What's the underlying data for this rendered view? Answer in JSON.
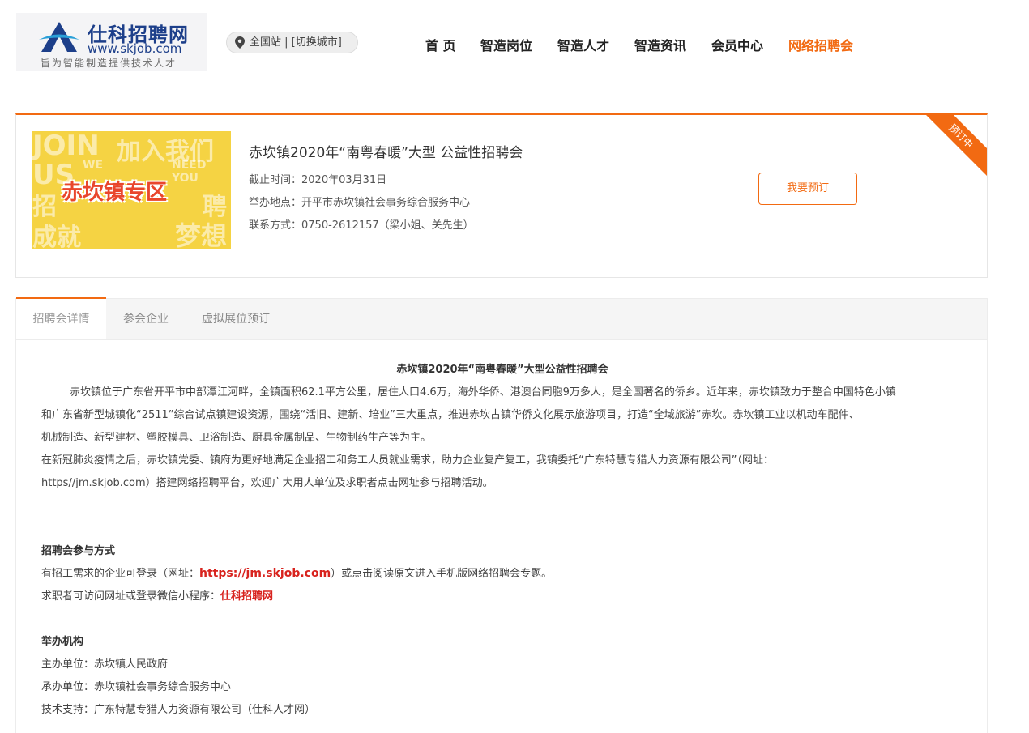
{
  "header": {
    "logo": {
      "name": "仕科招聘网",
      "url": "www.skjob.com",
      "slogan": "旨为智能制造提供技术人才"
    },
    "city_selector": "全国站 | [切换城市]",
    "nav": [
      {
        "label": "首 页"
      },
      {
        "label": "智造岗位"
      },
      {
        "label": "智造人才"
      },
      {
        "label": "智造资讯"
      },
      {
        "label": "会员中心"
      },
      {
        "label": "网络招聘会",
        "active": true
      }
    ]
  },
  "fair": {
    "banner": {
      "label": "赤坎镇专区",
      "bg_words": [
        "JOIN",
        "加入我们",
        "US",
        "WE",
        "NEED YOU",
        "招",
        "聘",
        "成就",
        "梦想"
      ]
    },
    "title": "赤坎镇2020年“南粤春暖”大型 公益性招聘会",
    "deadline": "截止时间：2020年03月31日",
    "location": "举办地点：开平市赤坎镇社会事务综合服务中心",
    "contact": "联系方式：0750-2612157（梁小姐、关先生）",
    "book_button": "我要预订",
    "status_ribbon": "预订中"
  },
  "tabs": [
    {
      "label": "招聘会详情",
      "active": true
    },
    {
      "label": "参会企业"
    },
    {
      "label": "虚拟展位预订"
    }
  ],
  "detail": {
    "heading": "赤坎镇2020年“南粤春暖”大型公益性招聘会",
    "intro_lines": [
      "赤坎镇位于广东省开平市中部潭江河畔，全镇面积62.1平方公里，居住人口4.6万，海外华侨、港澳台同胞9万多人，是全国著名的侨乡。近年来，赤坎镇致力于整合中国特色小镇",
      "和广东省新型城镇化“2511”综合试点镇建设资源，围绕“活旧、建新、培业”三大重点，推进赤坎古镇华侨文化展示旅游项目，打造“全域旅游”赤坎。赤坎镇工业以机动车配件、",
      "机械制造、新型建材、塑胶模具、卫浴制造、厨具金属制品、生物制药生产等为主。",
      "在新冠肺炎疫情之后，赤坎镇党委、镇府为更好地满足企业招工和务工人员就业需求，助力企业复产复工，我镇委托“广东特慧专猎人力资源有限公司”（网址：",
      "https//jm.skjob.com）搭建网络招聘平台，欢迎广大用人单位及求职者点击网址参与招聘活动。"
    ],
    "participation": {
      "heading": "招聘会参与方式",
      "line1_prefix": "有招工需求的企业可登录（网址：",
      "line1_link": "https://jm.skjob.com",
      "line1_suffix": "）或点击阅读原文进入手机版网络招聘会专题。",
      "line2_prefix": "求职者可访问网址或登录微信小程序：",
      "line2_link": "仕科招聘网"
    },
    "organizers": {
      "heading": "举办机构",
      "host": "主办单位：赤坎镇人民政府",
      "organizer": "承办单位：赤坎镇社会事务综合服务中心",
      "tech": "技术支持：广东特慧专猎人力资源有限公司（仕科人才网）"
    }
  },
  "colors": {
    "accent": "#f26a12",
    "logo_blue": "#1d3f8a",
    "link_red": "#d8231e",
    "banner_yellow": "#f5d343"
  }
}
